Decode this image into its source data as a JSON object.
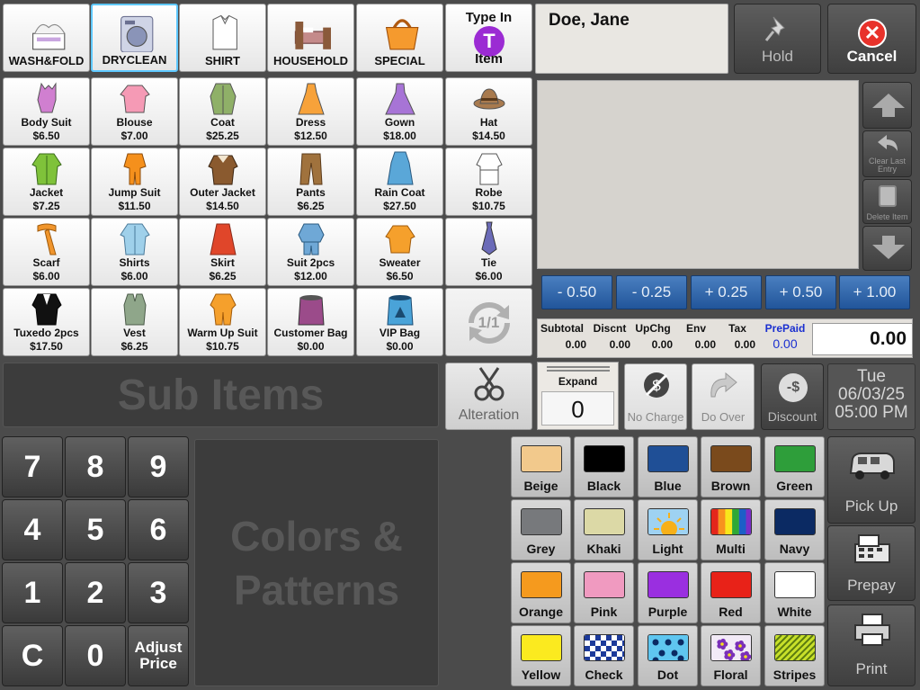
{
  "categories": [
    {
      "label": "WASH&FOLD",
      "icon": "laundry-basket-icon"
    },
    {
      "label": "DRYCLEAN",
      "icon": "washing-machine-icon",
      "active": true
    },
    {
      "label": "SHIRT",
      "icon": "folded-shirt-icon"
    },
    {
      "label": "HOUSEHOLD",
      "icon": "bed-icon"
    },
    {
      "label": "SPECIAL",
      "icon": "handbag-icon"
    }
  ],
  "type_in": {
    "line1": "Type In",
    "badge": "T",
    "line2": "Item"
  },
  "customer": {
    "name": "Doe, Jane"
  },
  "actions": {
    "hold": "Hold",
    "cancel": "Cancel"
  },
  "items": [
    {
      "name": "Body Suit",
      "price": "$6.50",
      "color": "#d07fd0",
      "icon": "bodysuit-icon"
    },
    {
      "name": "Blouse",
      "price": "$7.00",
      "color": "#f59ab5",
      "icon": "blouse-icon"
    },
    {
      "name": "Coat",
      "price": "$25.25",
      "color": "#8fb068",
      "icon": "coat-icon"
    },
    {
      "name": "Dress",
      "price": "$12.50",
      "color": "#f7a23a",
      "icon": "dress-icon"
    },
    {
      "name": "Gown",
      "price": "$18.00",
      "color": "#a774d6",
      "icon": "gown-icon"
    },
    {
      "name": "Hat",
      "price": "$14.50",
      "color": "#a87a4e",
      "icon": "hat-icon"
    },
    {
      "name": "Jacket",
      "price": "$7.25",
      "color": "#7fc23a",
      "icon": "jacket-icon"
    },
    {
      "name": "Jump Suit",
      "price": "$11.50",
      "color": "#f5901c",
      "icon": "jumpsuit-icon"
    },
    {
      "name": "Outer Jacket",
      "price": "$14.50",
      "color": "#8a5a2f",
      "icon": "outer-jacket-icon"
    },
    {
      "name": "Pants",
      "price": "$6.25",
      "color": "#a0723d",
      "icon": "pants-icon"
    },
    {
      "name": "Rain Coat",
      "price": "$27.50",
      "color": "#5aa7d8",
      "icon": "raincoat-icon"
    },
    {
      "name": "Robe",
      "price": "$10.75",
      "color": "#ffffff",
      "icon": "robe-icon"
    },
    {
      "name": "Scarf",
      "price": "$6.00",
      "color": "#f0952c",
      "icon": "scarf-icon"
    },
    {
      "name": "Shirts",
      "price": "$6.00",
      "color": "#9fd0ea",
      "icon": "shirts-icon"
    },
    {
      "name": "Skirt",
      "price": "$6.25",
      "color": "#e0462a",
      "icon": "skirt-icon"
    },
    {
      "name": "Suit 2pcs",
      "price": "$12.00",
      "color": "#6fa8d6",
      "icon": "suit-icon"
    },
    {
      "name": "Sweater",
      "price": "$6.50",
      "color": "#f5a02c",
      "icon": "sweater-icon"
    },
    {
      "name": "Tie",
      "price": "$6.00",
      "color": "#6b6bb8",
      "icon": "tie-icon"
    },
    {
      "name": "Tuxedo 2pcs",
      "price": "$17.50",
      "color": "#111111",
      "icon": "tuxedo-icon"
    },
    {
      "name": "Vest",
      "price": "$6.25",
      "color": "#8fa68a",
      "icon": "vest-icon"
    },
    {
      "name": "Warm Up Suit",
      "price": "$10.75",
      "color": "#f5a02c",
      "icon": "warmup-suit-icon"
    },
    {
      "name": "Customer Bag",
      "price": "$0.00",
      "color": "#9b4b8a",
      "icon": "customer-bag-icon"
    },
    {
      "name": "VIP Bag",
      "price": "$0.00",
      "color": "#4aa3d8",
      "icon": "vip-bag-icon"
    }
  ],
  "page_indicator": "1/1",
  "sub_items_title": "Sub Items",
  "colors_title_line1": "Colors &",
  "colors_title_line2": "Patterns",
  "alteration": "Alteration",
  "expand": {
    "label": "Expand",
    "value": "0"
  },
  "no_charge": "No Charge",
  "do_over": "Do Over",
  "discount": "Discount",
  "datetime": {
    "day": "Tue",
    "date": "06/03/25",
    "time": "05:00 PM"
  },
  "list_controls": {
    "clear_last": "Clear Last Entry",
    "delete_item": "Delete Item"
  },
  "adjust_buttons": [
    "- 0.50",
    "- 0.25",
    "+ 0.25",
    "+ 0.50",
    "+ 1.00"
  ],
  "totals": {
    "subtotal": {
      "label": "Subtotal",
      "value": "0.00"
    },
    "discount": {
      "label": "Discnt",
      "value": "0.00"
    },
    "upcharge": {
      "label": "UpChg",
      "value": "0.00"
    },
    "env": {
      "label": "Env",
      "value": "0.00"
    },
    "tax": {
      "label": "Tax",
      "value": "0.00"
    },
    "prepaid": {
      "label": "PrePaid",
      "value": "0.00"
    },
    "grand_total": "0.00"
  },
  "keypad": [
    "7",
    "8",
    "9",
    "4",
    "5",
    "6",
    "1",
    "2",
    "3",
    "C",
    "0"
  ],
  "adjust_price_line1": "Adjust",
  "adjust_price_line2": "Price",
  "colors": [
    {
      "name": "Beige",
      "swatch": "#f2c98c"
    },
    {
      "name": "Black",
      "swatch": "#000000"
    },
    {
      "name": "Blue",
      "swatch": "#1f4f96"
    },
    {
      "name": "Brown",
      "swatch": "#7a4a1c"
    },
    {
      "name": "Green",
      "swatch": "#2e9e3a"
    },
    {
      "name": "Grey",
      "swatch": "#77797c"
    },
    {
      "name": "Khaki",
      "swatch": "#dcd9a6"
    },
    {
      "name": "Light",
      "swatch": "pattern-sun"
    },
    {
      "name": "Multi",
      "swatch": "pattern-rainbow"
    },
    {
      "name": "Navy",
      "swatch": "#0b2a63"
    },
    {
      "name": "Orange",
      "swatch": "#f59a1e"
    },
    {
      "name": "Pink",
      "swatch": "#f09ac0"
    },
    {
      "name": "Purple",
      "swatch": "#9a2fe0"
    },
    {
      "name": "Red",
      "swatch": "#e82218"
    },
    {
      "name": "White",
      "swatch": "#ffffff"
    },
    {
      "name": "Yellow",
      "swatch": "#fbea1f"
    },
    {
      "name": "Check",
      "swatch": "pattern-check"
    },
    {
      "name": "Dot",
      "swatch": "pattern-dot"
    },
    {
      "name": "Floral",
      "swatch": "pattern-floral"
    },
    {
      "name": "Stripes",
      "swatch": "pattern-stripes"
    }
  ],
  "side": {
    "pickup": "Pick Up",
    "prepay": "Prepay",
    "print": "Print"
  }
}
